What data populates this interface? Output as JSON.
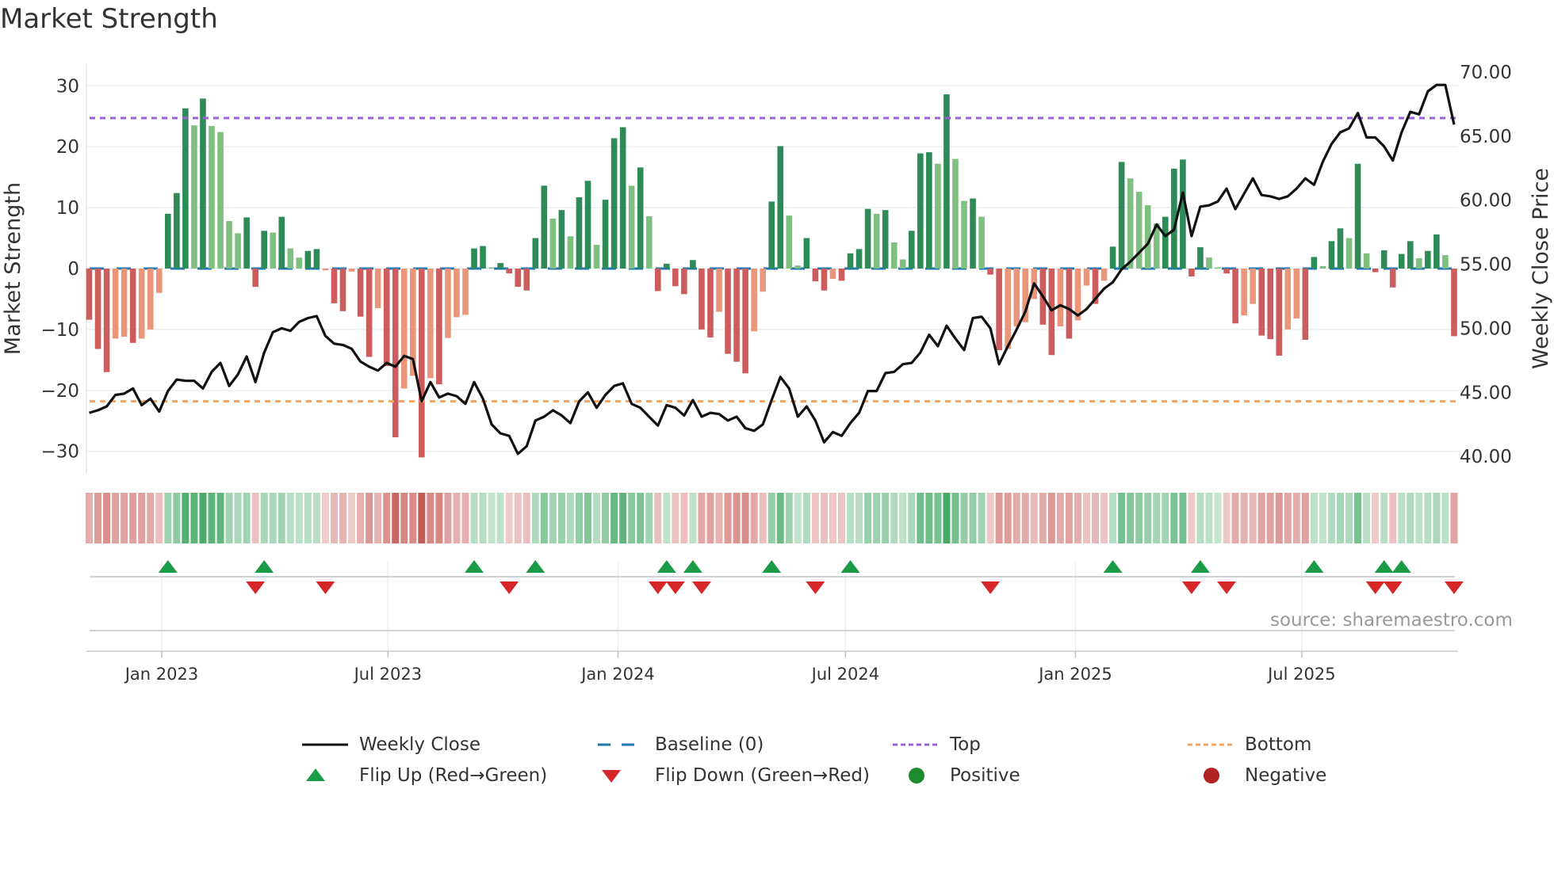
{
  "title": "Market Strength",
  "source": "source: sharemaestro.com",
  "colors": {
    "strong_pos": "#2e8b57",
    "weak_pos": "#7fbf7f",
    "strong_neg": "#cd5c5c",
    "weak_neg": "#e9967a",
    "line": "#111111",
    "baseline": "#1f77b4",
    "top": "#9b5fd6",
    "bottom": "#f4a460",
    "flip_up": "#1a9b45",
    "flip_down": "#d62728",
    "positive": "#1e8c2e",
    "negative": "#b22222",
    "grid": "#eceef3"
  },
  "legend": [
    {
      "label": "Weekly Close",
      "kind": "line"
    },
    {
      "label": "Baseline (0)",
      "kind": "baseline"
    },
    {
      "label": "Top",
      "kind": "top"
    },
    {
      "label": "Bottom",
      "kind": "bottom"
    },
    {
      "label": "Flip Up (Red→Green)",
      "kind": "up"
    },
    {
      "label": "Flip Down (Green→Red)",
      "kind": "down"
    },
    {
      "label": "Positive",
      "kind": "pos"
    },
    {
      "label": "Negative",
      "kind": "neg"
    }
  ],
  "chart_data": {
    "type": "bar",
    "title": "Market Strength",
    "ylabel": "Market Strength",
    "y2label": "Weekly Close Price",
    "ylim": [
      -35,
      34
    ],
    "y2lim": [
      38.45,
      70.65
    ],
    "yticks": [
      "30",
      "20",
      "10",
      "0",
      "−10",
      "−20",
      "−30"
    ],
    "ytick_values": [
      30,
      20,
      10,
      0,
      -10,
      -20,
      -30
    ],
    "y2ticks": [
      "70.00",
      "65.00",
      "60.00",
      "55.00",
      "50.00",
      "45.00",
      "40.00"
    ],
    "y2tick_values": [
      70,
      65,
      60,
      55,
      50,
      45,
      40
    ],
    "xticks": [
      {
        "label": "Jan 2023",
        "week": 9.29
      },
      {
        "label": "Jul 2023",
        "week": 35.15
      },
      {
        "label": "Jan 2024",
        "week": 61.44
      },
      {
        "label": "Jul 2024",
        "week": 87.44
      },
      {
        "label": "Jan 2025",
        "week": 113.73
      },
      {
        "label": "Jul 2025",
        "week": 139.59
      }
    ],
    "top_level": 24.7,
    "bottom_level": -21.8,
    "strength": [
      -8.4,
      -13.2,
      -17,
      -11.5,
      -11.2,
      -12.2,
      -11.5,
      -10,
      -4,
      9,
      12.4,
      26.3,
      23.5,
      27.9,
      23.4,
      22.4,
      7.8,
      5.8,
      8.4,
      -3,
      6.2,
      5.9,
      8.5,
      3.3,
      1.8,
      2.9,
      3.2,
      -0.3,
      -5.7,
      -7,
      -0.5,
      -7.9,
      -14.5,
      -6.5,
      -16,
      -27.7,
      -19.7,
      -17.6,
      -31,
      -18,
      -19,
      -11.4,
      -8,
      -7.6,
      3.3,
      3.7,
      0.2,
      0.9,
      -0.8,
      -3,
      -3.6,
      5,
      13.6,
      8.2,
      9.6,
      5.3,
      11.7,
      14.4,
      3.9,
      11.3,
      21.4,
      23.2,
      13.6,
      16.6,
      8.6,
      -3.7,
      0.8,
      -2.9,
      -4.2,
      1.4,
      -10,
      -11.3,
      -7.1,
      -14,
      -15.3,
      -17.2,
      -10.3,
      -3.8,
      11,
      20.1,
      8.7,
      0.5,
      5,
      -2.1,
      -3.6,
      -1.7,
      -2,
      2.5,
      3.2,
      9.8,
      9,
      9.6,
      4.3,
      1.5,
      6.2,
      18.9,
      19.1,
      17.2,
      28.6,
      18,
      11.1,
      11.5,
      8.5,
      -1,
      -13.4,
      -13.2,
      -9.5,
      -8.8,
      -5,
      -9.2,
      -14.2,
      -9.5,
      -11.5,
      -8.5,
      -2.8,
      -5.8,
      -2,
      3.6,
      17.5,
      14.8,
      12.6,
      10.4,
      7.4,
      8.5,
      16.4,
      17.9,
      -1.3,
      3.5,
      1.8,
      0.2,
      -0.8,
      -9,
      -7.7,
      -5.8,
      -11,
      -11.6,
      -14.3,
      -10,
      -8.2,
      -11.7,
      1.9,
      0.4,
      4.5,
      6.6,
      5,
      17.2,
      2.5,
      -0.6,
      3,
      -3.1,
      2.4,
      4.5,
      1.7,
      2.9,
      5.6,
      2.2,
      -11.1
    ],
    "strong": [
      1,
      1,
      1,
      0,
      0,
      1,
      0,
      0,
      0,
      1,
      1,
      1,
      0,
      1,
      0,
      0,
      0,
      0,
      1,
      1,
      1,
      0,
      1,
      0,
      0,
      1,
      1,
      0,
      1,
      1,
      0,
      1,
      1,
      0,
      1,
      1,
      0,
      0,
      1,
      0,
      1,
      0,
      0,
      0,
      1,
      1,
      0,
      1,
      1,
      1,
      1,
      1,
      1,
      0,
      1,
      0,
      1,
      1,
      0,
      1,
      1,
      1,
      0,
      1,
      0,
      1,
      1,
      1,
      1,
      1,
      1,
      1,
      0,
      1,
      1,
      1,
      0,
      0,
      1,
      1,
      0,
      0,
      1,
      1,
      1,
      0,
      1,
      1,
      1,
      1,
      0,
      1,
      0,
      0,
      1,
      1,
      1,
      0,
      1,
      0,
      0,
      1,
      0,
      1,
      1,
      0,
      0,
      0,
      0,
      1,
      1,
      0,
      1,
      0,
      0,
      1,
      0,
      1,
      1,
      0,
      0,
      0,
      0,
      1,
      1,
      1,
      1,
      1,
      0,
      0,
      1,
      1,
      0,
      0,
      1,
      1,
      1,
      0,
      0,
      1,
      1,
      0,
      1,
      1,
      0,
      1,
      0,
      1,
      1,
      1,
      1,
      1,
      0,
      1,
      1,
      0,
      1
    ],
    "weekly_close": [
      43.4,
      43.6,
      43.9,
      44.8,
      44.9,
      45.3,
      44.0,
      44.5,
      43.5,
      45.1,
      46.0,
      45.9,
      45.9,
      45.3,
      46.6,
      47.3,
      45.5,
      46.4,
      47.8,
      45.8,
      48.1,
      49.7,
      50.0,
      49.8,
      50.5,
      50.8,
      50.95,
      49.4,
      48.8,
      48.7,
      48.4,
      47.4,
      47.0,
      46.7,
      47.3,
      47.0,
      47.85,
      47.6,
      44.3,
      45.8,
      44.6,
      44.9,
      44.7,
      44.1,
      45.8,
      44.5,
      42.5,
      41.8,
      41.6,
      40.2,
      40.8,
      42.8,
      43.1,
      43.6,
      43.2,
      42.6,
      44.3,
      45.0,
      43.8,
      44.8,
      45.5,
      45.7,
      44.1,
      43.8,
      43.1,
      42.4,
      44.0,
      43.8,
      43.2,
      44.4,
      43.1,
      43.4,
      43.3,
      42.8,
      43.1,
      42.2,
      42.0,
      42.5,
      44.4,
      46.2,
      45.3,
      43.1,
      43.9,
      42.8,
      41.1,
      41.9,
      41.6,
      42.6,
      43.4,
      45.1,
      45.1,
      46.5,
      46.6,
      47.2,
      47.3,
      48.1,
      49.5,
      48.6,
      50.2,
      49.2,
      48.3,
      50.8,
      50.9,
      50.0,
      47.2,
      48.6,
      49.9,
      51.3,
      53.5,
      52.5,
      51.4,
      51.8,
      51.5,
      51.0,
      51.5,
      52.3,
      53.1,
      53.6,
      54.6,
      55.2,
      55.9,
      56.6,
      58.1,
      57.2,
      57.7,
      60.6,
      57.2,
      59.5,
      59.6,
      59.9,
      60.9,
      59.3,
      60.5,
      61.7,
      60.4,
      60.3,
      60.1,
      60.3,
      60.9,
      61.7,
      61.2,
      63.0,
      64.4,
      65.3,
      65.6,
      66.8,
      64.9,
      64.9,
      64.2,
      63.1,
      65.3,
      66.9,
      66.7,
      68.5,
      69.0,
      69.0,
      65.9
    ]
  }
}
